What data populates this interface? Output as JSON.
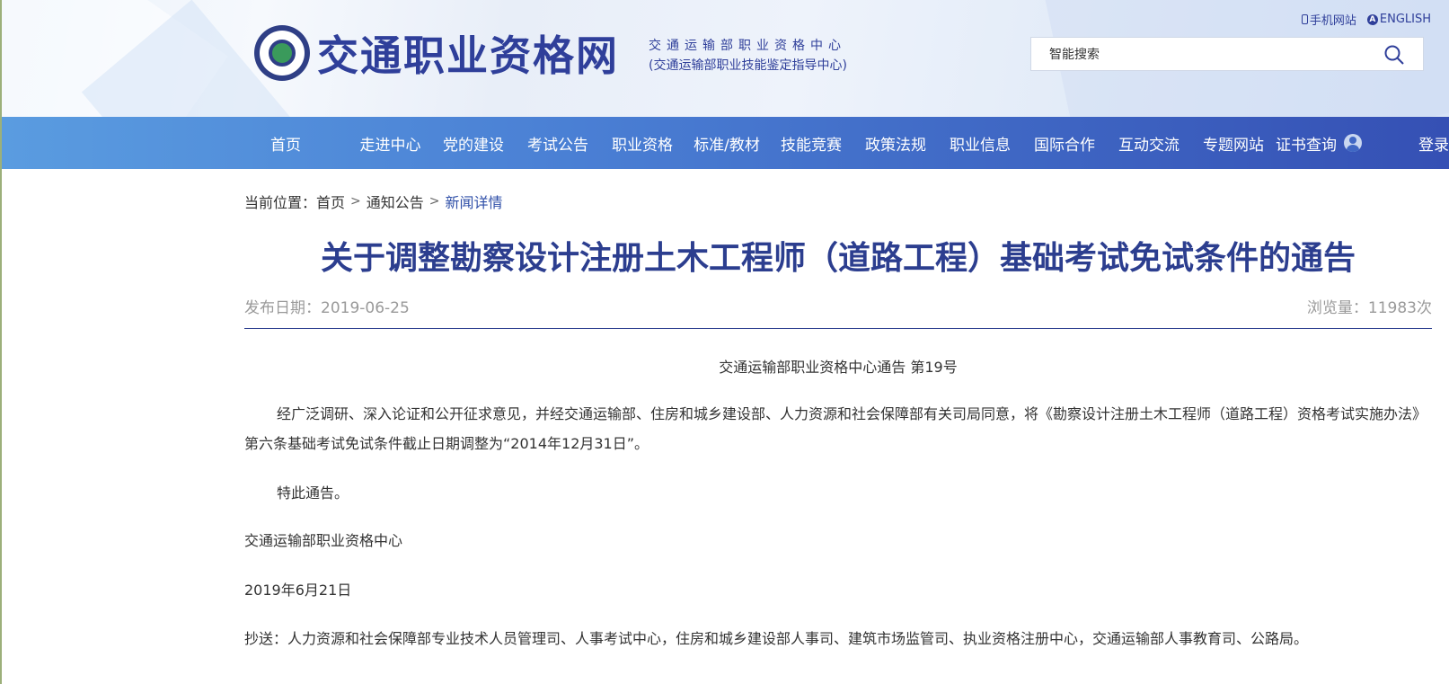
{
  "header": {
    "site_title": "交通职业资格网",
    "org_name": "交通运输部职业资格中心",
    "org_sub": "(交通运输部职业技能鉴定指导中心)",
    "mobile_link": "手机网站",
    "english_link": "ENGLISH",
    "search_placeholder": "智能搜索"
  },
  "nav": {
    "items": [
      "首页",
      "走进中心",
      "党的建设",
      "考试公告",
      "职业资格",
      "标准/教材",
      "技能竞赛",
      "政策法规",
      "职业信息",
      "国际合作",
      "互动交流",
      "专题网站",
      "证书查询",
      "登录"
    ]
  },
  "breadcrumb": {
    "label": "当前位置：",
    "home": "首页",
    "section": "通知公告",
    "current": "新闻详情",
    "separator": ">"
  },
  "article": {
    "title": "关于调整勘察设计注册土木工程师（道路工程）基础考试免试条件的通告",
    "publish_date": "发布日期：2019-06-25",
    "views": "浏览量：11983次",
    "doc_no": "交通运输部职业资格中心通告 第19号",
    "para1": "经广泛调研、深入论证和公开征求意见，并经交通运输部、住房和城乡建设部、人力资源和社会保障部有关司局同意，将《勘察设计注册土木工程师（道路工程）资格考试实施办法》第六条基础考试免试条件截止日期调整为“2014年12月31日”。",
    "para2": "特此通告。",
    "signature": "交通运输部职业资格中心",
    "sign_date": "2019年6月21日",
    "cc": "抄送：人力资源和社会保障部专业技术人员管理司、人事考试中心，住房和城乡建设部人事司、建筑市场监管司、执业资格注册中心，交通运输部人事教育司、公路局。"
  },
  "colors": {
    "brand_blue": "#2f3f9a",
    "title_blue": "#2c3e8f",
    "nav_start": "#5a9ce0",
    "nav_end": "#3550b4"
  }
}
